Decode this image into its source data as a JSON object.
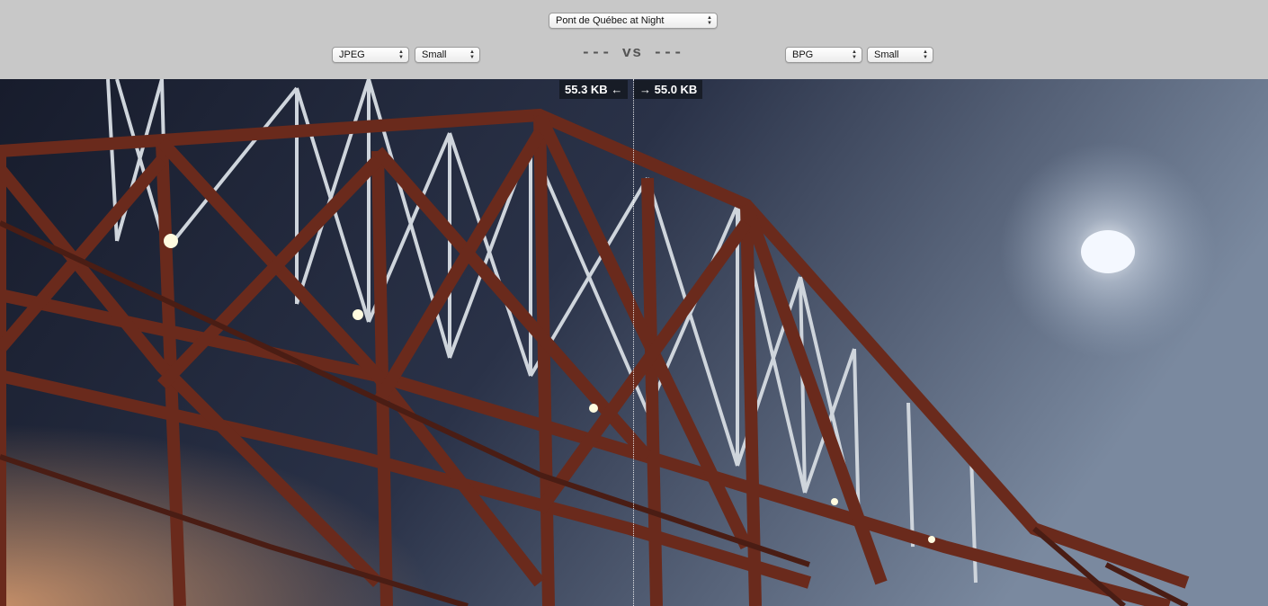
{
  "toolbar": {
    "image_select": {
      "value": "Pont de Québec at Night"
    },
    "left": {
      "codec_select": {
        "value": "JPEG"
      },
      "size_select": {
        "value": "Small"
      }
    },
    "right": {
      "codec_select": {
        "value": "BPG"
      },
      "size_select": {
        "value": "Small"
      }
    },
    "vs_label": {
      "left": "---",
      "middle": "vs",
      "right": "---"
    }
  },
  "viewer": {
    "left_size": "55.3 KB",
    "right_size": "55.0 KB",
    "left_arrow": "←",
    "right_arrow": "→",
    "colors": {
      "sky_dark": "#1c2235",
      "sky_light": "#6a7a92",
      "bridge_red": "#5a2418",
      "bridge_white": "#d8dde2",
      "moon": "#f4f8ff",
      "glow": "#f6c890"
    }
  }
}
